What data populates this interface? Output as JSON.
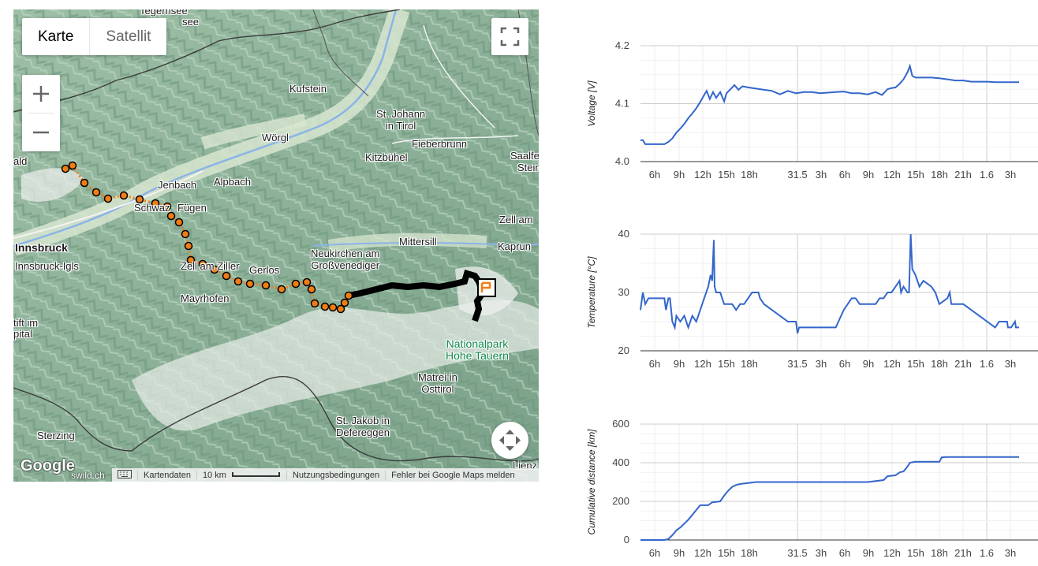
{
  "map": {
    "map_type_buttons": [
      "Karte",
      "Satellit"
    ],
    "zoom_in_label": "+",
    "zoom_out_label": "−",
    "labels": {
      "tegernsee": "Tegernsee",
      "see": "see",
      "kufstein": "Kufstein",
      "st_johann": "St. Johann",
      "in_tirol": "in Tirol",
      "woergl": "Wörgl",
      "fieberbrunn": "Fieberbrunn",
      "kitzbuehel": "Kitzbühel",
      "saalfe": "Saalfe",
      "stein": "Stein",
      "jenbach": "Jenbach",
      "alpbach": "Alpbach",
      "schwaz": "Schwaz",
      "fuegen": "Fügen",
      "zell_am": "Zell am",
      "innsbruck": "Innsbruck",
      "innsbruck_igls": "Innsbruck-Igls",
      "mittersill": "Mittersill",
      "kaprun": "Kaprun",
      "neukirchen": "Neukirchen am",
      "grossvenediger": "Großvenediger",
      "zell_am_ziller": "Zell am Ziller",
      "gerlos": "Gerlos",
      "mayrhofen": "Mayrhofen",
      "stift_im": "tift im",
      "spital": "pital",
      "nationalpark": "Nationalpark",
      "hohe_tauern": "Hohe Tauern",
      "matrei": "Matrei in",
      "osttirol": "Osttirol",
      "sterzing": "Sterzing",
      "st_jakob": "St. Jakob in",
      "defereggen": "Defereggen",
      "wald": "ald",
      "lienz": "Lienz"
    },
    "google_logo": "Google",
    "swild": "swild.ch",
    "attribution": {
      "kartendaten": "Kartendaten",
      "scale": "10 km",
      "nutzungsbedingungen": "Nutzungsbedingungen",
      "fehler": "Fehler bei Google Maps melden"
    },
    "colors": {
      "track": "#f07d14",
      "track_dark": "#000000"
    }
  },
  "chart_data": [
    {
      "type": "line",
      "ylabel": "Voltage [V]",
      "ylim": [
        4.0,
        4.2
      ],
      "yticks": [
        "4.0",
        "4.1",
        "4.2"
      ],
      "x_ticks": [
        "6h",
        "9h",
        "12h",
        "15h",
        "18h",
        "31.5",
        "3h",
        "6h",
        "9h",
        "12h",
        "15h",
        "18h",
        "21h",
        "1.6",
        "3h"
      ],
      "x_range_hours": [
        3.5,
        51
      ],
      "grid": true,
      "color": "#3366cc",
      "points": [
        [
          3.5,
          4.037
        ],
        [
          3.8,
          4.037
        ],
        [
          4.1,
          4.03
        ],
        [
          6.5,
          4.03
        ],
        [
          7,
          4.034
        ],
        [
          7.5,
          4.04
        ],
        [
          8,
          4.05
        ],
        [
          8.5,
          4.057
        ],
        [
          9,
          4.065
        ],
        [
          9.5,
          4.075
        ],
        [
          10,
          4.083
        ],
        [
          10.5,
          4.092
        ],
        [
          11,
          4.103
        ],
        [
          11.5,
          4.115
        ],
        [
          11.8,
          4.122
        ],
        [
          12.2,
          4.108
        ],
        [
          12.6,
          4.12
        ],
        [
          13,
          4.11
        ],
        [
          13.5,
          4.12
        ],
        [
          14,
          4.104
        ],
        [
          14.3,
          4.118
        ],
        [
          14.8,
          4.125
        ],
        [
          15.3,
          4.132
        ],
        [
          15.8,
          4.124
        ],
        [
          16.3,
          4.13
        ],
        [
          17,
          4.128
        ],
        [
          18,
          4.126
        ],
        [
          19,
          4.124
        ],
        [
          20,
          4.122
        ],
        [
          21,
          4.116
        ],
        [
          22,
          4.122
        ],
        [
          23,
          4.118
        ],
        [
          24,
          4.12
        ],
        [
          25,
          4.12
        ],
        [
          26,
          4.118
        ],
        [
          27,
          4.119
        ],
        [
          28,
          4.12
        ],
        [
          29,
          4.121
        ],
        [
          30,
          4.118
        ],
        [
          31,
          4.118
        ],
        [
          32,
          4.116
        ],
        [
          33,
          4.12
        ],
        [
          33.8,
          4.115
        ],
        [
          34.5,
          4.125
        ],
        [
          35,
          4.127
        ],
        [
          35.5,
          4.128
        ],
        [
          36,
          4.134
        ],
        [
          36.5,
          4.142
        ],
        [
          37,
          4.154
        ],
        [
          37.3,
          4.165
        ],
        [
          37.6,
          4.148
        ],
        [
          38,
          4.145
        ],
        [
          39,
          4.145
        ],
        [
          40,
          4.145
        ],
        [
          41,
          4.144
        ],
        [
          42,
          4.142
        ],
        [
          43,
          4.14
        ],
        [
          44,
          4.14
        ],
        [
          45,
          4.138
        ],
        [
          46,
          4.138
        ],
        [
          47,
          4.138
        ],
        [
          48,
          4.137
        ],
        [
          49,
          4.137
        ],
        [
          50,
          4.137
        ],
        [
          51,
          4.137
        ]
      ]
    },
    {
      "type": "line",
      "ylabel": "Temperature [°C]",
      "ylim": [
        20,
        40
      ],
      "yticks": [
        "20",
        "30",
        "40"
      ],
      "x_ticks": [
        "6h",
        "9h",
        "12h",
        "15h",
        "18h",
        "31.5",
        "3h",
        "6h",
        "9h",
        "12h",
        "15h",
        "18h",
        "21h",
        "1.6",
        "3h"
      ],
      "x_range_hours": [
        3.5,
        51
      ],
      "grid": true,
      "color": "#3366cc",
      "points": [
        [
          3.5,
          27
        ],
        [
          3.8,
          30
        ],
        [
          4.1,
          28
        ],
        [
          4.5,
          29
        ],
        [
          6.5,
          29
        ],
        [
          6.7,
          27
        ],
        [
          7,
          29
        ],
        [
          7.2,
          29
        ],
        [
          7.5,
          25
        ],
        [
          7.8,
          24
        ],
        [
          8,
          26
        ],
        [
          8.5,
          25
        ],
        [
          9,
          26
        ],
        [
          9.5,
          24
        ],
        [
          10,
          26
        ],
        [
          10.5,
          25
        ],
        [
          11,
          27
        ],
        [
          11.5,
          29
        ],
        [
          12,
          31
        ],
        [
          12.3,
          33
        ],
        [
          12.5,
          32
        ],
        [
          12.7,
          39
        ],
        [
          12.8,
          31
        ],
        [
          13,
          30
        ],
        [
          13.5,
          30
        ],
        [
          14,
          28
        ],
        [
          14.5,
          28
        ],
        [
          15,
          28
        ],
        [
          15.5,
          27
        ],
        [
          16,
          28
        ],
        [
          16.5,
          28
        ],
        [
          17,
          29
        ],
        [
          17.5,
          30
        ],
        [
          18,
          30
        ],
        [
          18.3,
          30
        ],
        [
          18.5,
          29
        ],
        [
          19,
          28
        ],
        [
          20,
          27
        ],
        [
          21,
          26
        ],
        [
          22,
          25
        ],
        [
          23,
          25
        ],
        [
          23.2,
          23
        ],
        [
          23.4,
          24
        ],
        [
          25,
          24
        ],
        [
          26,
          24
        ],
        [
          27,
          24
        ],
        [
          28,
          24
        ],
        [
          29,
          27
        ],
        [
          29.5,
          28
        ],
        [
          30,
          29
        ],
        [
          30.5,
          29
        ],
        [
          31,
          28
        ],
        [
          32,
          28
        ],
        [
          33,
          28
        ],
        [
          33.5,
          29
        ],
        [
          34,
          29
        ],
        [
          34.5,
          30
        ],
        [
          35,
          30
        ],
        [
          35.5,
          31
        ],
        [
          36,
          32
        ],
        [
          36.2,
          30
        ],
        [
          36.5,
          31
        ],
        [
          37,
          30
        ],
        [
          37.2,
          30
        ],
        [
          37.4,
          40
        ],
        [
          37.6,
          34
        ],
        [
          38,
          33
        ],
        [
          38.5,
          31
        ],
        [
          39,
          32
        ],
        [
          40,
          31
        ],
        [
          40.5,
          30
        ],
        [
          41,
          28
        ],
        [
          42,
          29
        ],
        [
          42.3,
          30
        ],
        [
          42.5,
          28
        ],
        [
          43,
          28
        ],
        [
          44,
          28
        ],
        [
          45,
          27
        ],
        [
          46,
          26
        ],
        [
          47,
          25
        ],
        [
          48,
          24
        ],
        [
          48.5,
          25
        ],
        [
          49,
          25
        ],
        [
          49.5,
          25
        ],
        [
          49.6,
          24
        ],
        [
          50,
          24
        ],
        [
          50.5,
          25
        ],
        [
          50.6,
          24
        ],
        [
          51,
          24
        ]
      ]
    },
    {
      "type": "line",
      "ylabel": "Cumulative distance [km]",
      "ylim": [
        0,
        600
      ],
      "yticks": [
        "0",
        "200",
        "400",
        "600"
      ],
      "x_ticks": [
        "6h",
        "9h",
        "12h",
        "15h",
        "18h",
        "31.5",
        "3h",
        "6h",
        "9h",
        "12h",
        "15h",
        "18h",
        "21h",
        "1.6",
        "3h"
      ],
      "x_range_hours": [
        3.5,
        51
      ],
      "grid": true,
      "color": "#3366cc",
      "points": [
        [
          3.5,
          0
        ],
        [
          6.5,
          0
        ],
        [
          7,
          5
        ],
        [
          7.5,
          25
        ],
        [
          8,
          50
        ],
        [
          8.5,
          65
        ],
        [
          9,
          85
        ],
        [
          9.5,
          105
        ],
        [
          10,
          130
        ],
        [
          10.5,
          155
        ],
        [
          11,
          180
        ],
        [
          12,
          180
        ],
        [
          12.5,
          195
        ],
        [
          13.5,
          200
        ],
        [
          14,
          230
        ],
        [
          14.5,
          255
        ],
        [
          15,
          275
        ],
        [
          15.5,
          285
        ],
        [
          16,
          290
        ],
        [
          17,
          295
        ],
        [
          18,
          300
        ],
        [
          20,
          300
        ],
        [
          22,
          300
        ],
        [
          24,
          300
        ],
        [
          26,
          300
        ],
        [
          28,
          300
        ],
        [
          30,
          300
        ],
        [
          32,
          300
        ],
        [
          33,
          305
        ],
        [
          34,
          310
        ],
        [
          34.5,
          330
        ],
        [
          35.5,
          335
        ],
        [
          36,
          350
        ],
        [
          36.5,
          355
        ],
        [
          37,
          380
        ],
        [
          37.3,
          400
        ],
        [
          38,
          405
        ],
        [
          39,
          405
        ],
        [
          40,
          405
        ],
        [
          41,
          405
        ],
        [
          41.3,
          428
        ],
        [
          42,
          430
        ],
        [
          44,
          430
        ],
        [
          46,
          430
        ],
        [
          48,
          430
        ],
        [
          50,
          430
        ],
        [
          51,
          430
        ]
      ]
    }
  ]
}
